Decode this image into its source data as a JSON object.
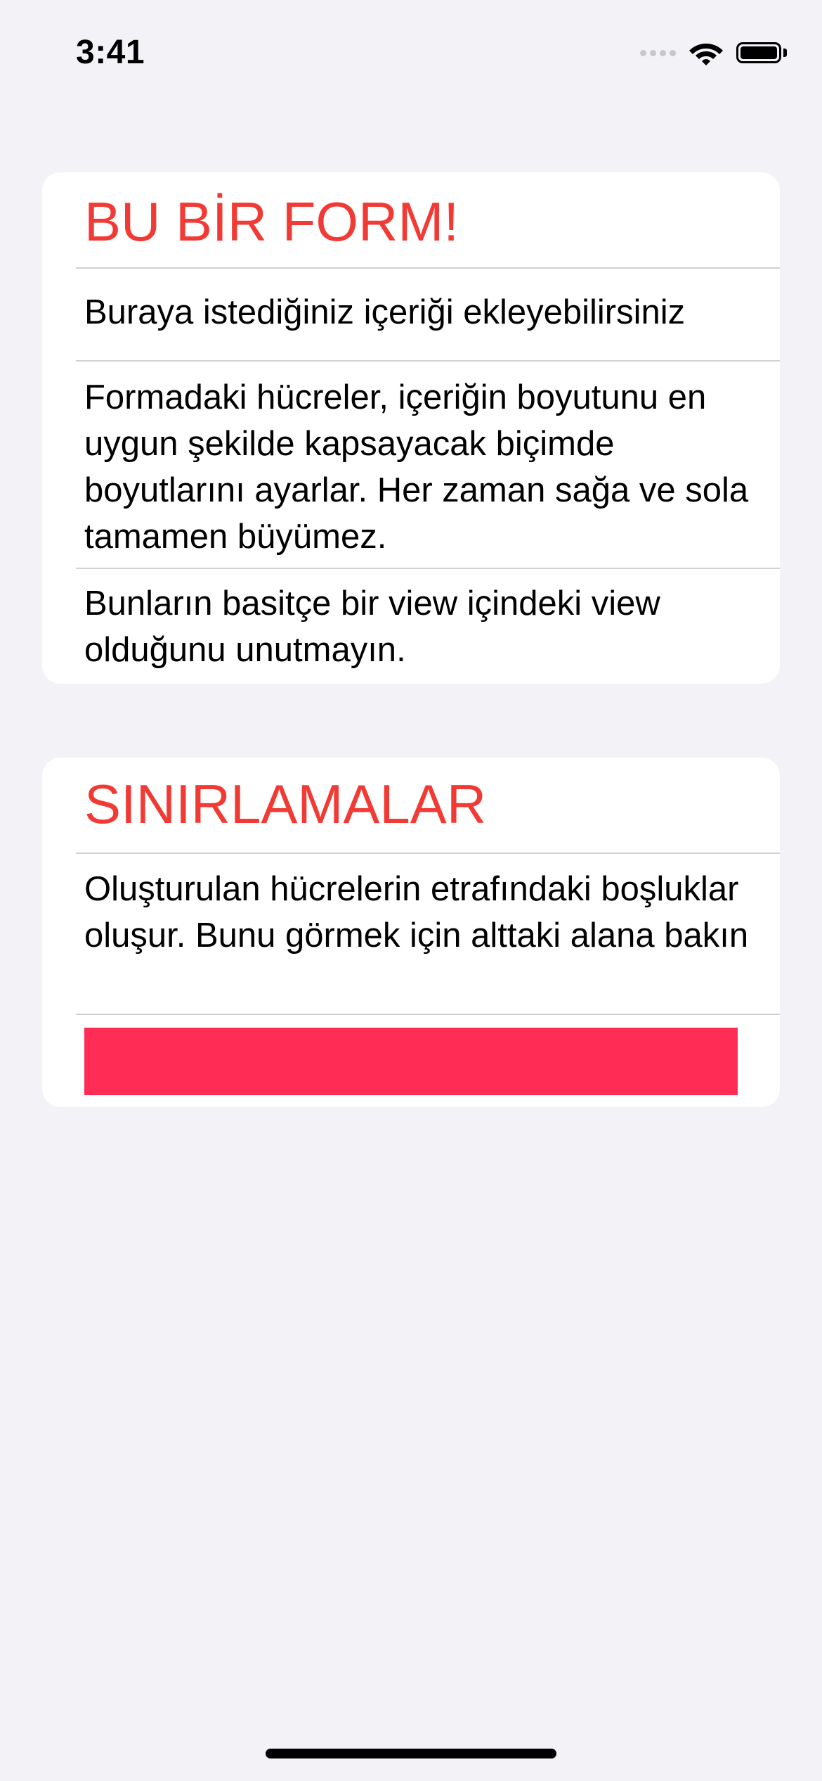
{
  "status_bar": {
    "time": "3:41",
    "icons": [
      "signal-icon",
      "wifi-icon",
      "battery-icon"
    ]
  },
  "colors": {
    "background": "#f2f2f7",
    "card": "#ffffff",
    "accent_red": "#f23a35",
    "box_pink": "#ff2d55",
    "separator": "#d1d1d6"
  },
  "form": {
    "sections": [
      {
        "title": "BU BİR FORM!",
        "rows": [
          "Buraya istediğiniz içeriği ekleyebilirsiniz",
          "Formadaki hücreler, içeriğin boyutunu en uygun şekilde kapsayacak biçimde boyutlarını ayarlar. Her zaman sağa ve sola tamamen büyümez.",
          "Bunların basitçe bir view içindeki view olduğunu unutmayın."
        ]
      },
      {
        "title": "SINIRLAMALAR",
        "rows": [
          "Oluşturulan hücrelerin etrafındaki boşluklar oluşur. Bunu görmek için alttaki alana bakın"
        ]
      }
    ]
  }
}
